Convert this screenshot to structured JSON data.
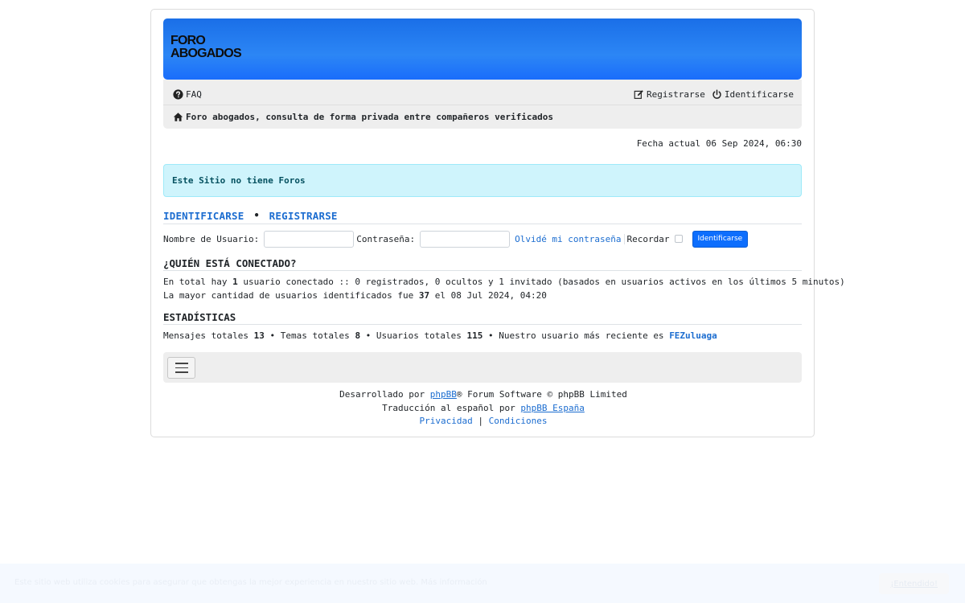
{
  "header": {
    "logo_line1": "FORO",
    "logo_line2": "ABOGADOS"
  },
  "nav": {
    "faq": "FAQ",
    "register": "Registrarse",
    "login": "Identificarse",
    "breadcrumb": "Foro abogados, consulta de forma privada entre compañeros verificados"
  },
  "current_date": "Fecha actual 06 Sep 2024, 06:30",
  "alert": "Este Sitio no tiene Foros",
  "login": {
    "tab_login": "IDENTIFICARSE",
    "separator": "•",
    "tab_register": "REGISTRARSE",
    "username_label": "Nombre de Usuario:",
    "username_value": "",
    "password_label": "Contraseña:",
    "password_value": "",
    "forgot": "Olvidé mi contraseña",
    "remember": "Recordar",
    "submit": "Identificarse"
  },
  "online": {
    "title": "¿QUIÉN ESTÁ CONECTADO?",
    "line1_prefix": "En total hay ",
    "line1_count": "1",
    "line1_suffix": " usuario conectado :: 0 registrados, 0 ocultos y 1 invitado (basados en usuarios activos en los últimos 5 minutos)",
    "line2_prefix": "La mayor cantidad de usuarios identificados fue ",
    "line2_count": "37",
    "line2_suffix": " el 08 Jul 2024, 04:20"
  },
  "stats": {
    "title": "ESTADÍSTICAS",
    "posts_label": "Mensajes totales ",
    "posts": "13",
    "topics_label": " • Temas totales ",
    "topics": "8",
    "users_label": " • Usuarios totales ",
    "users": "115",
    "newest_label": " • Nuestro usuario más reciente es ",
    "newest": "FEZuluaga"
  },
  "footer": {
    "powered_prefix": "Desarrollado por ",
    "powered_link": "phpBB",
    "powered_suffix": "® Forum Software © phpBB Limited",
    "translation_prefix": "Traducción al español por ",
    "translation_link": "phpBB España",
    "privacy": "Privacidad",
    "pipe": "|",
    "terms": "Condiciones"
  },
  "cookie_bar": {
    "text": "Este sitio web utiliza cookies para asegurar que obtengas la mejor experiencia en nuestro sitio web. Más información",
    "button": "¡Entendido!"
  },
  "colors": {
    "banner": "#1a6fe8",
    "link": "#1c6dd0",
    "alert_bg": "#cff4fc",
    "button": "#0d6efd"
  }
}
